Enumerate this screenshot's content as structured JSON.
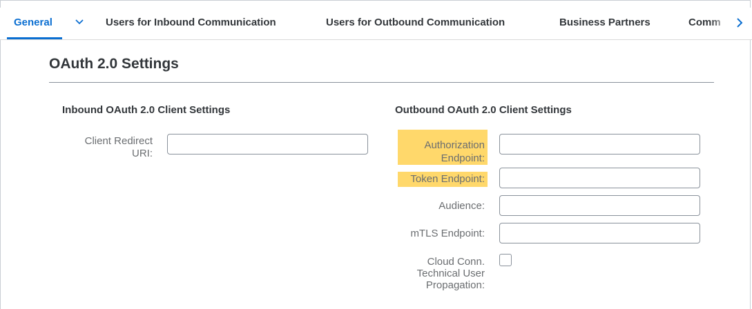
{
  "tabs": {
    "general": "General",
    "inbound_users": "Users for Inbound Communication",
    "outbound_users": "Users for Outbound Communication",
    "business_partners": "Business Partners",
    "truncated": "Comm"
  },
  "section": {
    "title": "OAuth 2.0 Settings"
  },
  "inbound": {
    "title": "Inbound OAuth 2.0 Client Settings",
    "client_redirect_uri_label_1": "Client Redirect",
    "client_redirect_uri_label_2": "URI:",
    "client_redirect_uri_value": ""
  },
  "outbound": {
    "title": "Outbound OAuth 2.0 Client Settings",
    "authorization_endpoint_label_1": "Authorization",
    "authorization_endpoint_label_2": "Endpoint:",
    "token_endpoint_label": "Token Endpoint:",
    "audience_label": "Audience:",
    "mtls_endpoint_label": "mTLS Endpoint:",
    "cloud_conn_label_1": "Cloud Conn.",
    "cloud_conn_label_2": "Technical User",
    "cloud_conn_label_3": "Propagation:",
    "cloud_conn_checked": false,
    "highlight_color": "#ffd86b"
  },
  "colors": {
    "accent": "#0a6ed1",
    "text": "#32363a",
    "label": "#6a6d70",
    "border": "#89919a"
  }
}
